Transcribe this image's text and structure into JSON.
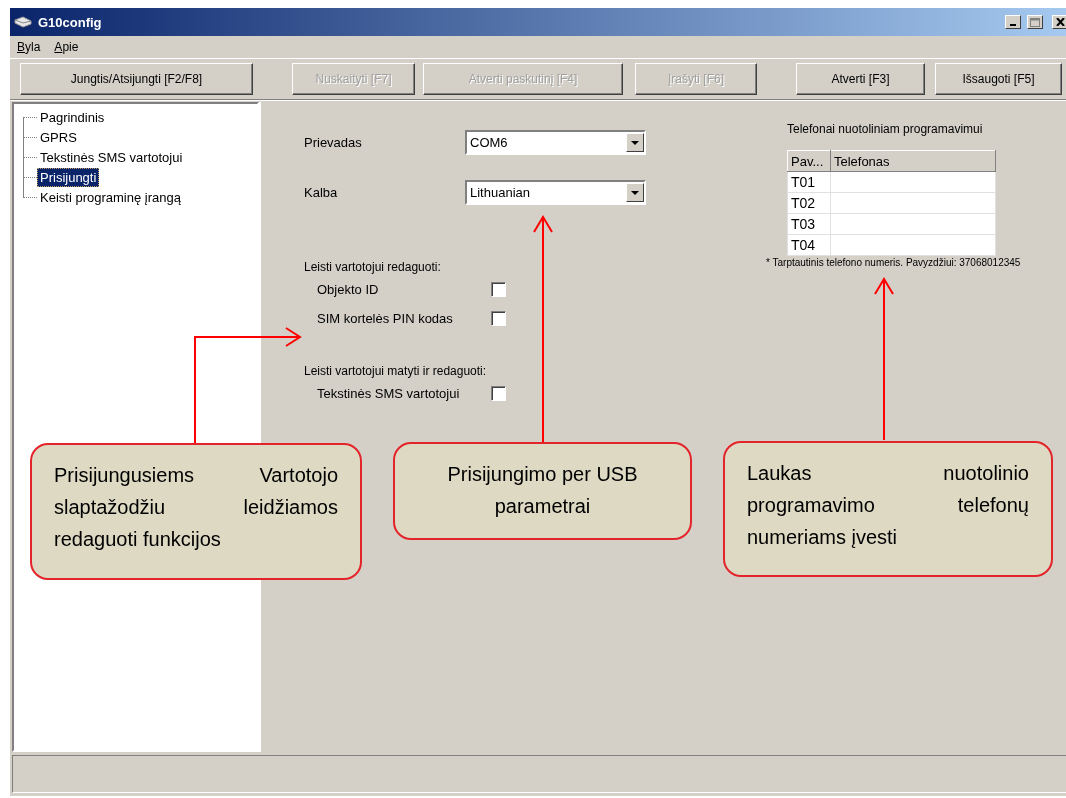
{
  "window": {
    "title": "G10config"
  },
  "menu": [
    {
      "label": "Byla"
    },
    {
      "label": "Apie"
    }
  ],
  "toolbar": [
    {
      "label": "Jungtis/Atsijungti [F2/F8]",
      "disabled": false
    },
    {
      "label": "Nuskaityti [F7]",
      "disabled": true
    },
    {
      "label": "Atverti paskutinį [F4]",
      "disabled": true
    },
    {
      "label": "Įrašyti [F6]",
      "disabled": true
    },
    {
      "label": "Atverti [F3]",
      "disabled": false
    },
    {
      "label": "Išsaugoti [F5]",
      "disabled": false
    }
  ],
  "tree": [
    {
      "label": "Pagrindinis",
      "selected": false
    },
    {
      "label": "GPRS",
      "selected": false
    },
    {
      "label": "Tekstinės SMS vartotojui",
      "selected": false
    },
    {
      "label": "Prisijungti",
      "selected": true
    },
    {
      "label": "Keisti programinę įrangą",
      "selected": false
    }
  ],
  "form": {
    "fields": [
      {
        "label": "Prievadas",
        "value": "COM6"
      },
      {
        "label": "Kalba",
        "value": "Lithuanian"
      }
    ],
    "groups": [
      {
        "title": "Leisti vartotojui redaguoti:",
        "options": [
          {
            "label": "Objekto ID",
            "checked": false
          },
          {
            "label": "SIM kortelės PIN kodas",
            "checked": false
          }
        ]
      },
      {
        "title": "Leisti vartotojui matyti ir redaguoti:",
        "options": [
          {
            "label": "Tekstinės SMS vartotojui",
            "checked": false
          }
        ]
      }
    ]
  },
  "phones": {
    "title": "Telefonai nuotoliniam programavimui",
    "columns": [
      "Pav...",
      "Telefonas"
    ],
    "rows": [
      "T01",
      "T02",
      "T03",
      "T04"
    ],
    "note": "* Tarptautinis telefono numeris. Pavyzdžiui: 37068012345"
  },
  "callouts": [
    {
      "text": "Prisijungusiems Vartotojo slaptažodžiu leidžiamos redaguoti funkcijos",
      "kind": "justified"
    },
    {
      "text": "Prisijungimo per USB parametrai",
      "kind": "centered"
    },
    {
      "text": "Laukas nuotolinio programavimo telefonų numeriams įvesti",
      "kind": "justified"
    }
  ]
}
